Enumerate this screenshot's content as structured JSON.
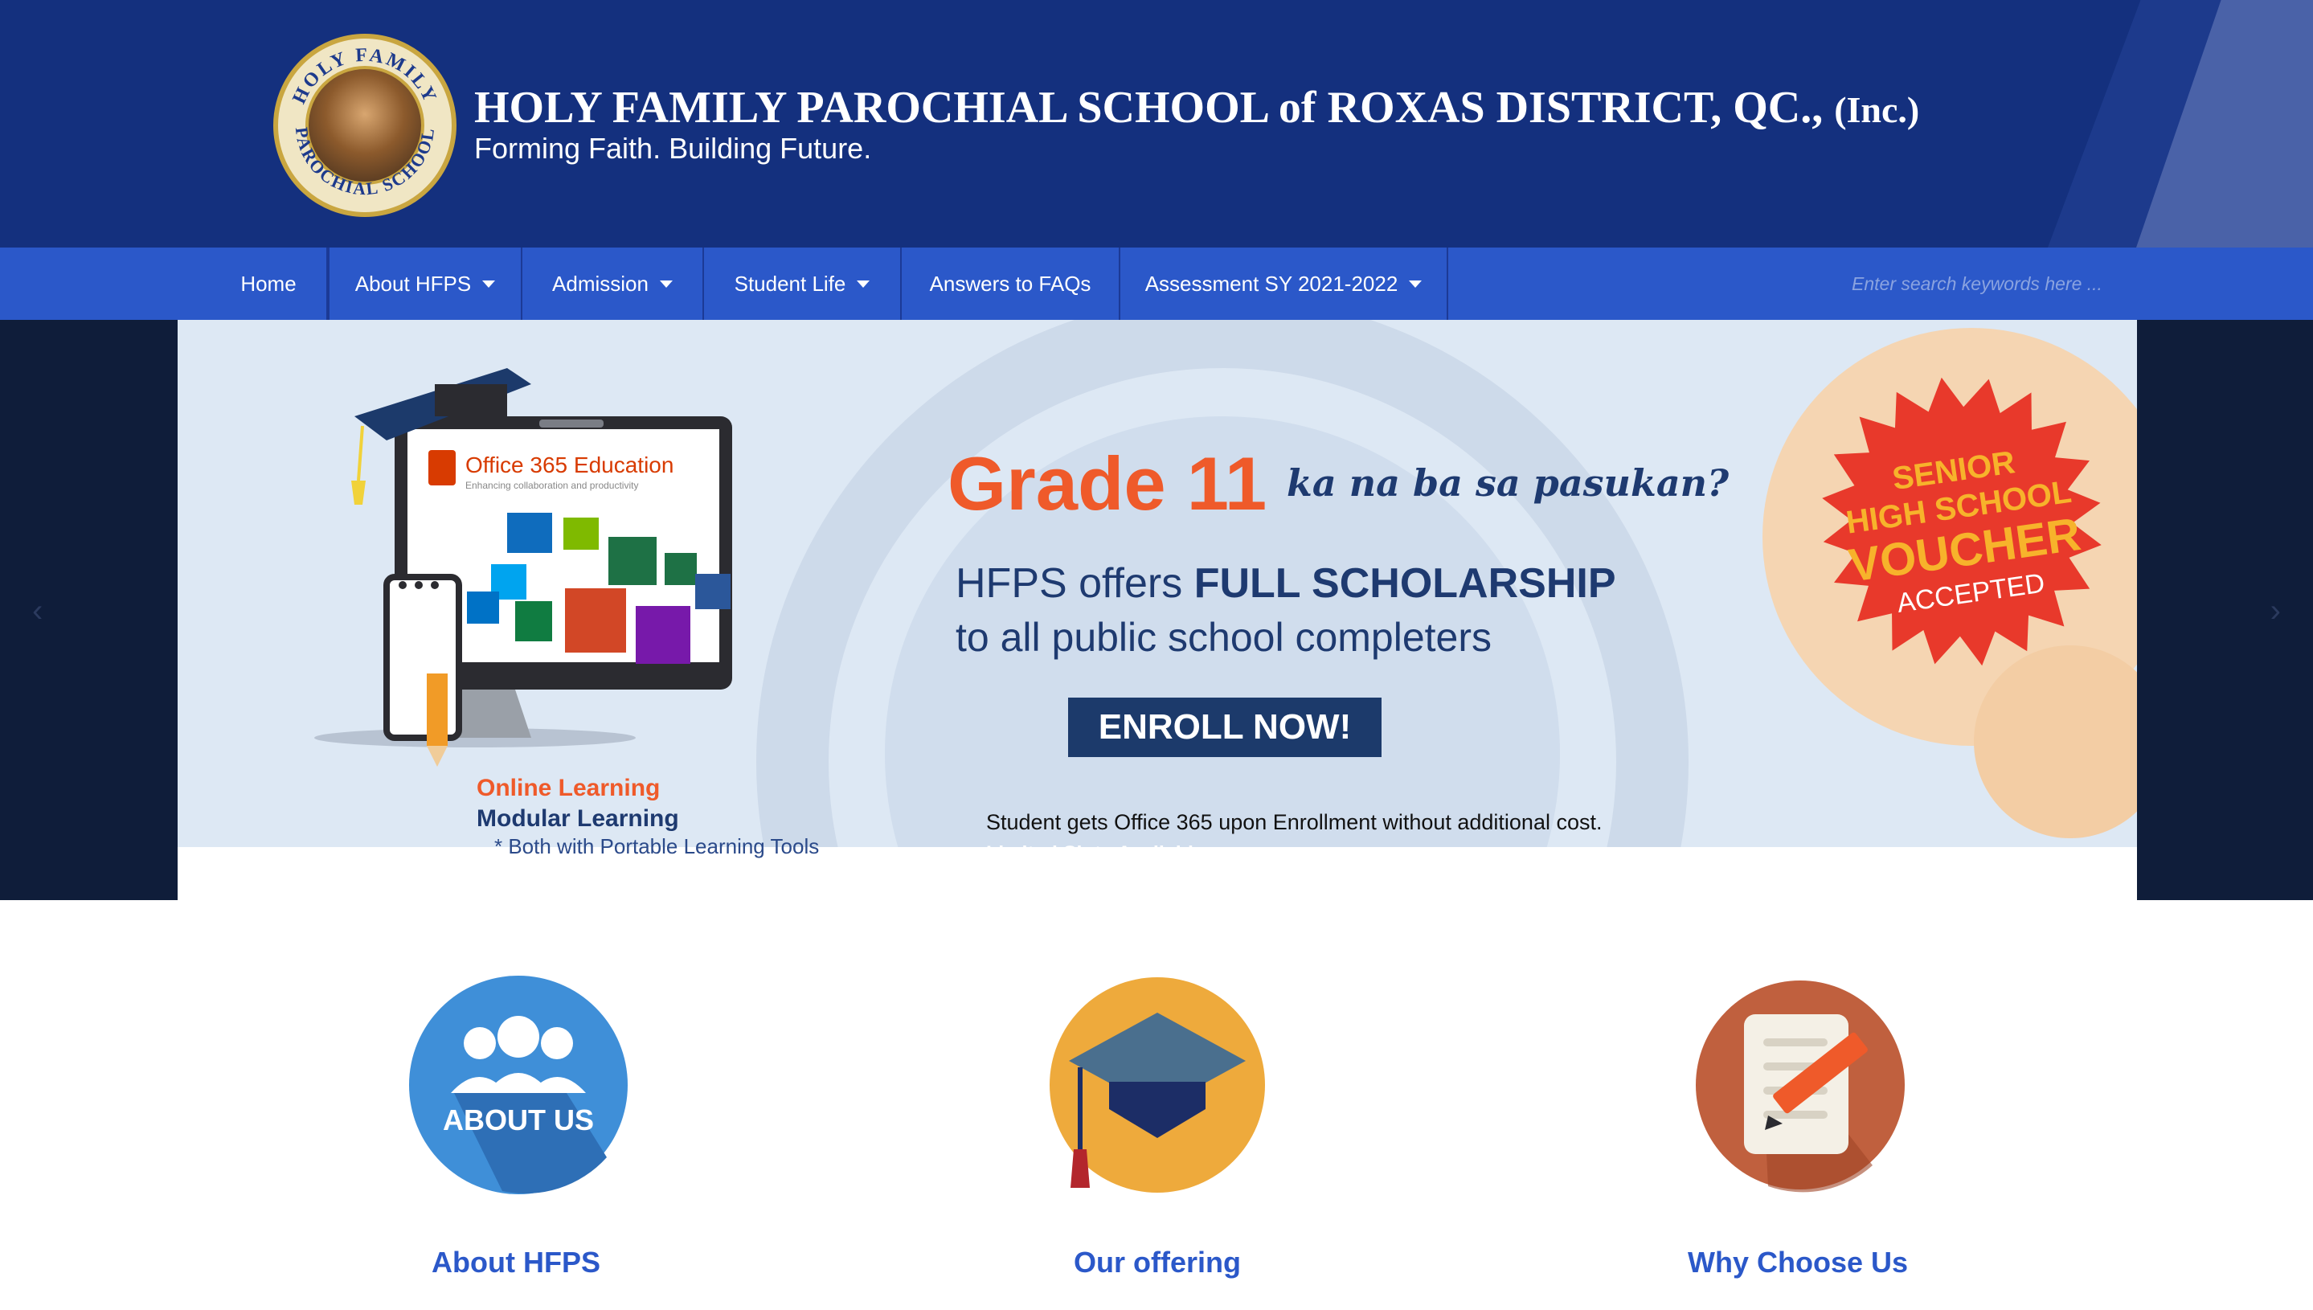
{
  "header": {
    "school_name": "HOLY FAMILY PAROCHIAL SCHOOL of ROXAS DISTRICT, QC.,",
    "school_suffix": "(Inc.)",
    "tagline": "Forming Faith. Building Future.",
    "logo_text_top": "HOLY FAMILY",
    "logo_text_bottom": "PAROCHIAL SCHOOL"
  },
  "nav": {
    "items": [
      {
        "label": "Home",
        "dropdown": false
      },
      {
        "label": "About HFPS",
        "dropdown": true
      },
      {
        "label": "Admission",
        "dropdown": true
      },
      {
        "label": "Student Life",
        "dropdown": true
      },
      {
        "label": "Answers to FAQs",
        "dropdown": false
      },
      {
        "label": "Assessment SY 2021-2022",
        "dropdown": true
      }
    ],
    "search_placeholder": "Enter search keywords here ..."
  },
  "slider": {
    "office_title": "Office 365 Education",
    "office_subtitle": "Enhancing collaboration and productivity",
    "online_learning": "Online Learning",
    "modular_learning": "Modular Learning",
    "learning_tools": "* Both with Portable Learning Tools",
    "grade": "Grade 11",
    "grade_script": "ka na ba sa pasukan?",
    "offer_prefix": "HFPS offers",
    "offer_bold": "FULL SCHOLARSHIP",
    "offer_line2": "to all public school completers",
    "enroll_label": "ENROLL NOW!",
    "office_note": "Student gets Office 365 upon Enrollment without additional cost.",
    "limited": "Limited Slots Available.",
    "voucher_line1": "SENIOR",
    "voucher_line2": "HIGH SCHOOL",
    "voucher_line3": "VOUCHER",
    "voucher_line4": "ACCEPTED"
  },
  "features": [
    {
      "title": "About HFPS",
      "icon_text": "ABOUT US",
      "icon": "about-us-icon",
      "color": "#3f8fd8"
    },
    {
      "title": "Our offering",
      "icon": "graduation-cap-icon",
      "color": "#eeaa3c"
    },
    {
      "title": "Why Choose Us",
      "icon": "document-pencil-icon",
      "color": "#c0603e"
    }
  ],
  "colors": {
    "header_bg": "#14307e",
    "nav_bg": "#2b58c9",
    "accent_orange": "#ef5a2a",
    "navy_text": "#1e3a70",
    "link_blue": "#2b58c9"
  }
}
